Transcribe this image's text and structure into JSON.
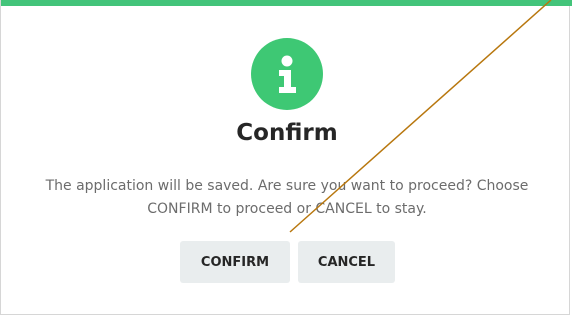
{
  "dialog": {
    "accent_color": "#43c47a",
    "icon": "info-icon",
    "icon_color": "#3ec874",
    "title": "Confirm",
    "message_line1": "The application will be saved. Are sure you want to proceed? Choose",
    "message_line2": "CONFIRM to proceed or CANCEL to stay.",
    "buttons": {
      "confirm_label": "CONFIRM",
      "cancel_label": "CANCEL"
    }
  },
  "overlay": {
    "line_color": "#b8770e"
  }
}
